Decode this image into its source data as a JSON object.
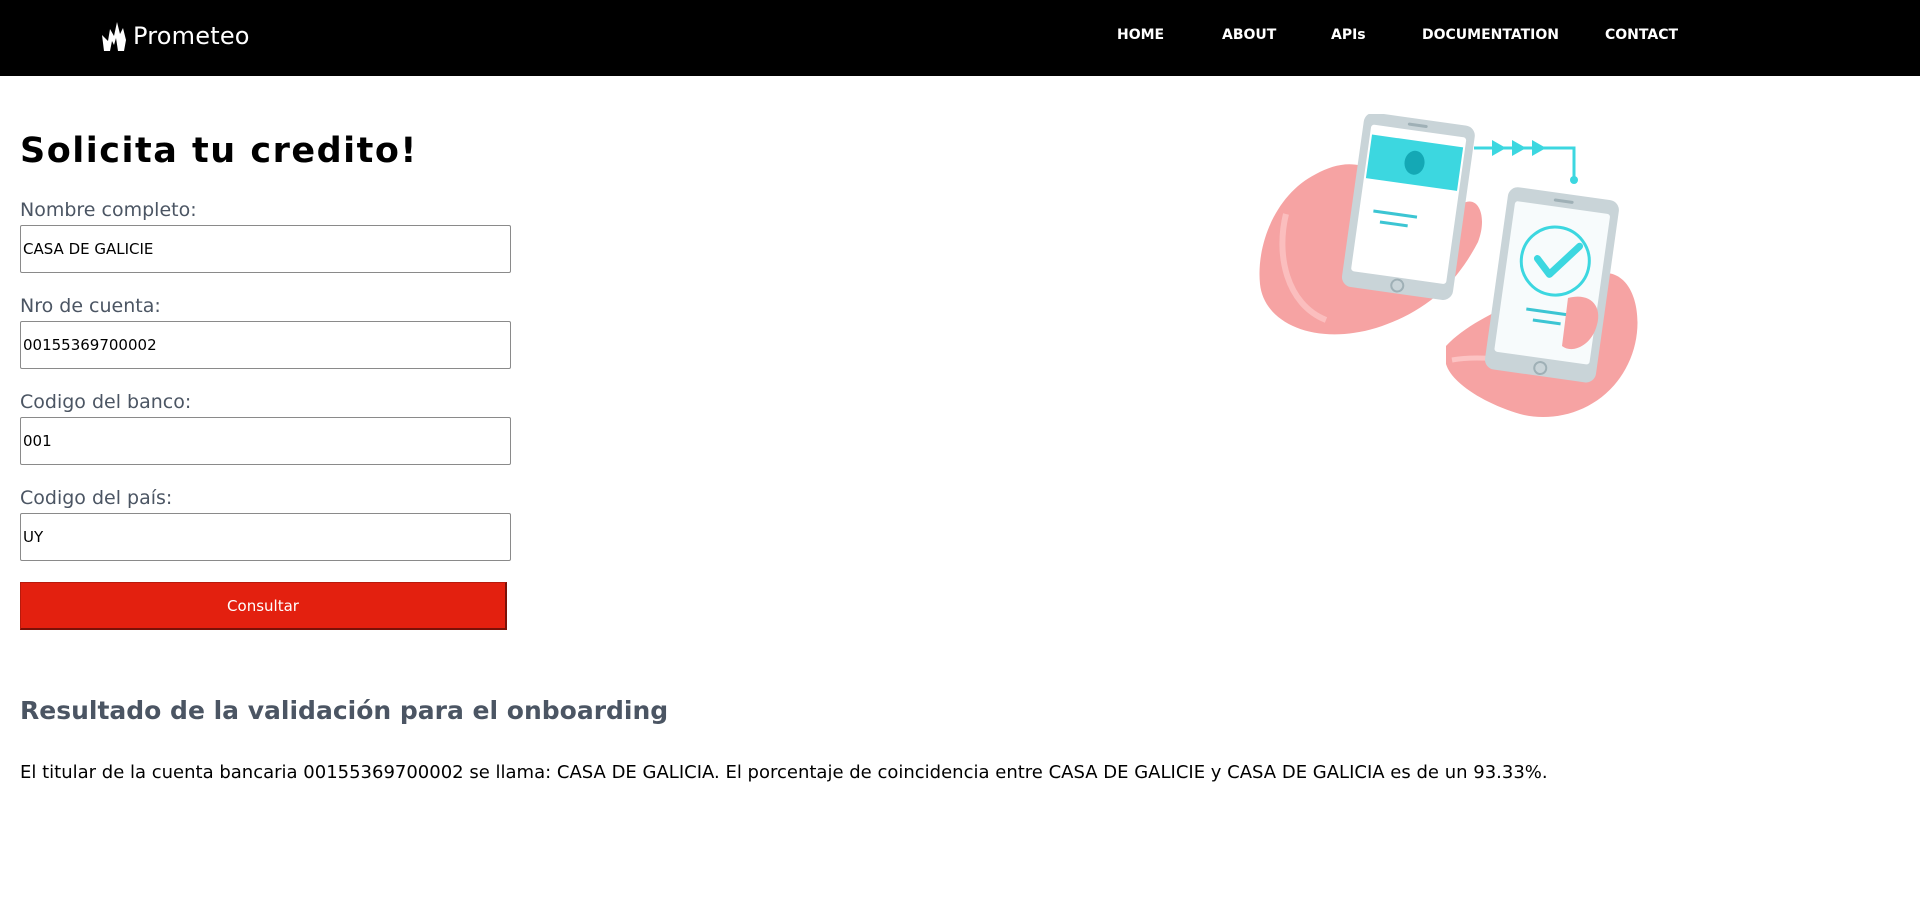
{
  "header": {
    "brand": "Prometeo",
    "nav": [
      {
        "label": "HOME"
      },
      {
        "label": "ABOUT"
      },
      {
        "label": "APIs"
      },
      {
        "label": "DOCUMENTATION"
      },
      {
        "label": "CONTACT"
      }
    ]
  },
  "form": {
    "title": "Solicita tu credito!",
    "fields": [
      {
        "label": "Nombre completo:",
        "value": "CASA DE GALICIE"
      },
      {
        "label": "Nro de cuenta:",
        "value": "00155369700002"
      },
      {
        "label": "Codigo del banco:",
        "value": "001"
      },
      {
        "label": "Codigo del país:",
        "value": "UY"
      }
    ],
    "submit_label": "Consultar"
  },
  "result": {
    "heading": "Resultado de la validación para el onboarding",
    "message": "El titular de la cuenta bancaria 00155369700002 se llama: CASA DE GALICIA. El porcentaje de coincidencia entre CASA DE GALICIE y CASA DE GALICIA es de un 93.33%."
  },
  "colors": {
    "navbar_bg": "#000000",
    "accent_button": "#e3200f",
    "label_text": "#4b5563"
  },
  "icons": {
    "brand_logo": "flame-logo-icon",
    "illustration": "phone-payment-illustration"
  }
}
